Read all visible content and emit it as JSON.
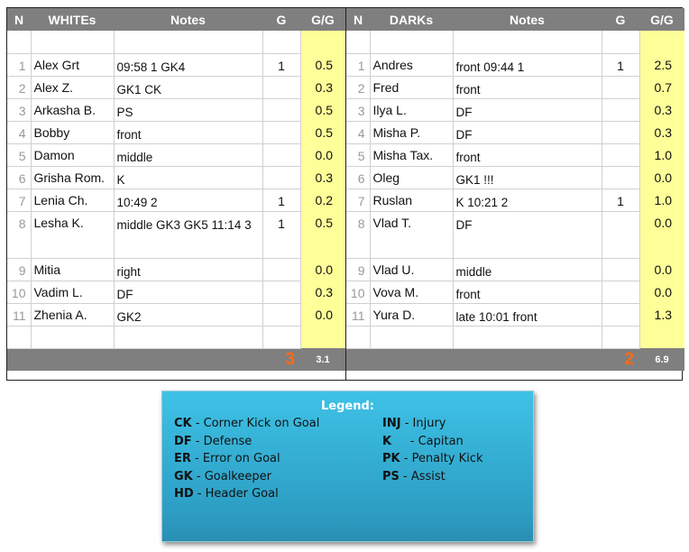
{
  "whites": {
    "header": [
      "N",
      "WHITEs",
      "Notes",
      "G",
      "G/G"
    ],
    "rows": [
      {
        "n": "1",
        "name": "Alex Grt",
        "notes": "09:58 1  GK4",
        "g": "1",
        "gg": "0.5"
      },
      {
        "n": "2",
        "name": "Alex Z.",
        "notes": "GK1  CK",
        "g": "",
        "gg": "0.3"
      },
      {
        "n": "3",
        "name": "Arkasha B.",
        "notes": "PS",
        "g": "",
        "gg": "0.5"
      },
      {
        "n": "4",
        "name": "Bobby",
        "notes": "front",
        "g": "",
        "gg": "0.5"
      },
      {
        "n": "5",
        "name": "Damon",
        "notes": "middle",
        "g": "",
        "gg": "0.0"
      },
      {
        "n": "6",
        "name": "Grisha Rom.",
        "notes": "K",
        "g": "",
        "gg": "0.3"
      },
      {
        "n": "7",
        "name": "Lenia Ch.",
        "notes": "10:49 2",
        "g": "1",
        "gg": "0.2"
      },
      {
        "n": "8",
        "name": "Lesha K.",
        "notes": "middle  GK3  GK5  11:14 3",
        "g": "1",
        "gg": "0.5"
      },
      {
        "n": "9",
        "name": "Mitia",
        "notes": "right",
        "g": "",
        "gg": "0.0"
      },
      {
        "n": "10",
        "name": "Vadim L.",
        "notes": "DF",
        "g": "",
        "gg": "0.3"
      },
      {
        "n": "11",
        "name": "Zhenia A.",
        "notes": "GK2",
        "g": "",
        "gg": "0.0"
      }
    ],
    "total_goals": "3",
    "total_gg": "3.1"
  },
  "darks": {
    "header": [
      "N",
      "DARKs",
      "Notes",
      "G",
      "G/G"
    ],
    "rows": [
      {
        "n": "1",
        "name": "Andres",
        "notes": "front 09:44 1",
        "g": "1",
        "gg": "2.5"
      },
      {
        "n": "2",
        "name": "Fred",
        "notes": "front",
        "g": "",
        "gg": "0.7"
      },
      {
        "n": "3",
        "name": "Ilya L.",
        "notes": "DF",
        "g": "",
        "gg": "0.3"
      },
      {
        "n": "4",
        "name": "Misha P.",
        "notes": "DF",
        "g": "",
        "gg": "0.3"
      },
      {
        "n": "5",
        "name": "Misha Tax.",
        "notes": "front",
        "g": "",
        "gg": "1.0"
      },
      {
        "n": "6",
        "name": "Oleg",
        "notes": "GK1 !!!",
        "g": "",
        "gg": "0.0"
      },
      {
        "n": "7",
        "name": "Ruslan",
        "notes": "K  10:21 2",
        "g": "1",
        "gg": "1.0"
      },
      {
        "n": "8",
        "name": "Vlad T.",
        "notes": "DF",
        "g": "",
        "gg": "0.0"
      },
      {
        "n": "9",
        "name": "Vlad U.",
        "notes": "middle",
        "g": "",
        "gg": "0.0"
      },
      {
        "n": "10",
        "name": "Vova M.",
        "notes": "front",
        "g": "",
        "gg": "0.0"
      },
      {
        "n": "11",
        "name": "Yura D.",
        "notes": "late  10:01 front",
        "g": "",
        "gg": "1.3"
      }
    ],
    "total_goals": "2",
    "total_gg": "6.9"
  },
  "legend": {
    "title": "Legend:",
    "left": [
      {
        "code": "CK",
        "desc": " - Corner Kick on Goal"
      },
      {
        "code": "DF",
        "desc": " - Defense"
      },
      {
        "code": "ER",
        "desc": " - Error on Goal"
      },
      {
        "code": "GK",
        "desc": " - Goalkeeper"
      },
      {
        "code": "HD",
        "desc": " - Header Goal"
      }
    ],
    "right": [
      {
        "code": "INJ",
        "desc": " - Injury"
      },
      {
        "code": "K",
        "desc": "     - Capitan"
      },
      {
        "code": "PK",
        "desc": " - Penalty Kick"
      },
      {
        "code": "PS",
        "desc": " - Assist"
      }
    ]
  },
  "colors": {
    "header": "#7f7f7f",
    "gg_column": "#ffff99",
    "total_goals": "#ff6a13",
    "legend": "#3ab8dc"
  }
}
